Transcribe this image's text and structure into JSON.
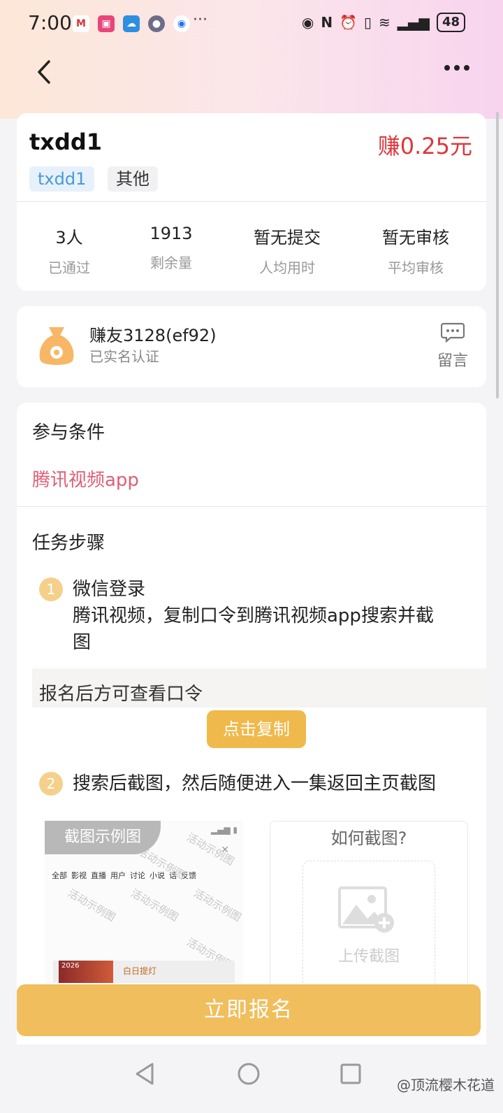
{
  "status": {
    "time": "7:00",
    "more": "···",
    "battery": "48"
  },
  "nav": {
    "back_icon": "chevron-left-icon",
    "more_icon": "more-horizontal-icon"
  },
  "task": {
    "title": "txdd1",
    "reward": "赚0.25元",
    "tags": [
      "txdd1",
      "其他"
    ],
    "stats": [
      {
        "value": "3人",
        "label": "已通过"
      },
      {
        "value": "1913",
        "label": "剩余量"
      },
      {
        "value": "暂无提交",
        "label": "人均用时"
      },
      {
        "value": "暂无审核",
        "label": "平均审核"
      }
    ]
  },
  "publisher": {
    "name": "赚友3128(ef92)",
    "verified": "已实名认证",
    "message_label": "留言"
  },
  "conditions": {
    "title": "参与条件",
    "value": "腾讯视频app"
  },
  "steps": {
    "title": "任务步骤",
    "step1_num": "1",
    "step1_title": "微信登录",
    "step1_desc_line1": "腾讯视频，复制口令到腾讯视频app搜索并截",
    "step1_desc_line2": "图",
    "code_text": "报名后方可查看口令",
    "copy_button": "点击复制",
    "step2_num": "2",
    "step2_title": "搜索后截图，然后随便进入一集返回主页截图"
  },
  "example": {
    "label": "截图示例图",
    "tabs": [
      "全部",
      "影视",
      "直播",
      "用户",
      "讨论",
      "小说",
      "话",
      "反馈"
    ],
    "watermark": "活动示例图",
    "thumb_text": "白日提灯",
    "thumb_year": "2026"
  },
  "upload": {
    "title": "如何截图?",
    "label": "上传截图"
  },
  "actions": {
    "signup": "立即报名"
  },
  "footer": {
    "watermark": "@顶流樱木花道"
  }
}
